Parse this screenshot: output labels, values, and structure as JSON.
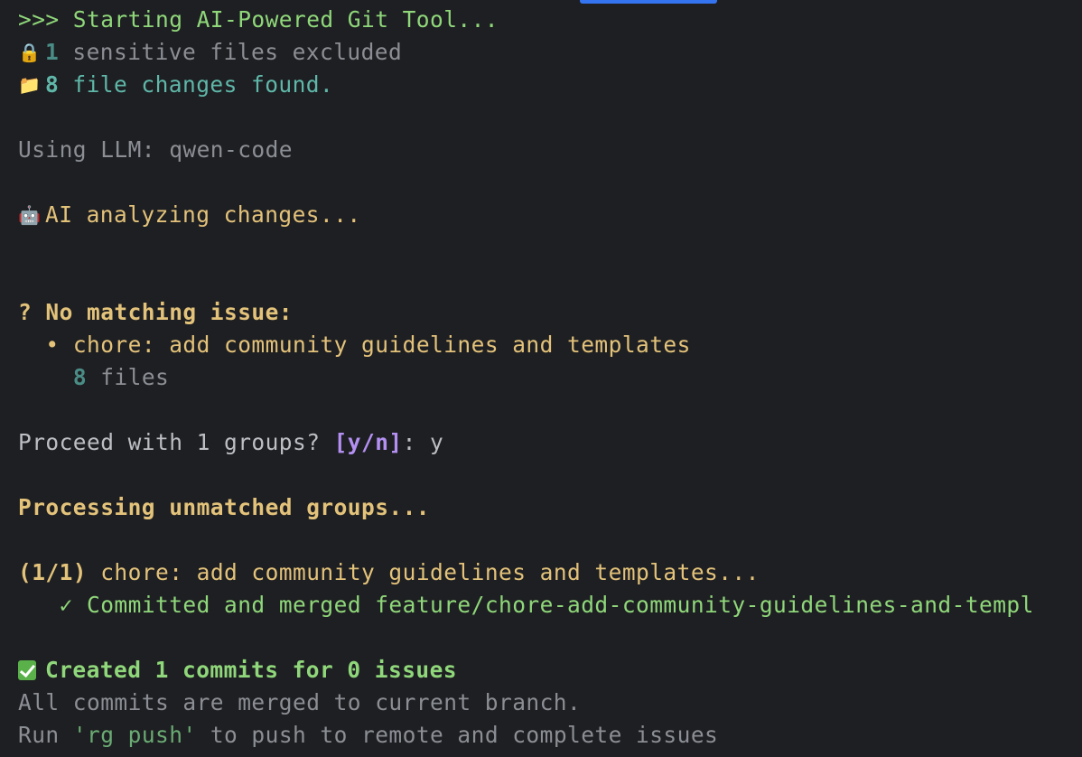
{
  "terminal": {
    "line1": ">>> Starting AI-Powered Git Tool...",
    "sensitive_icon": "🔒",
    "sensitive_count": "1",
    "sensitive_text": " sensitive files excluded",
    "changes_icon": "📁",
    "changes_count": "8",
    "changes_text": " file changes found.",
    "llm_line": "Using LLM: qwen-code",
    "robot_icon": "🤖",
    "analyzing_text": "AI analyzing changes...",
    "no_match_heading": "? No matching issue:",
    "group_bullet": "  • ",
    "group_title": "chore: add community guidelines and templates",
    "group_files_count": "8",
    "group_files_label": " files",
    "proceed_prompt": "Proceed with 1 groups? ",
    "proceed_options": "[y/n]",
    "proceed_colon": ": ",
    "proceed_answer": "y",
    "processing_heading": "Processing unmatched groups...",
    "progress_index": "(1/1)",
    "progress_title": " chore: add community guidelines and templates...",
    "commit_check": "   ✓ ",
    "commit_text": "Committed and merged feature/chore-add-community-guidelines-and-templ",
    "created_text": "Created 1 commits for 0 issues",
    "merged_text": "All commits are merged to current branch.",
    "run_prefix": "Run ",
    "run_command": "'rg push'",
    "run_suffix": " to push to remote and complete issues"
  },
  "colors": {
    "background": "#1e1f22",
    "green": "#8fd77a",
    "gray": "#8b8e94",
    "teal": "#5fb7a9",
    "yellow": "#e3c27a",
    "purple": "#b390f2",
    "tab_accent": "#3574f0"
  },
  "icons": [
    "lock-icon",
    "folder-icon",
    "robot-icon",
    "check-mark-icon",
    "check-box-icon"
  ]
}
